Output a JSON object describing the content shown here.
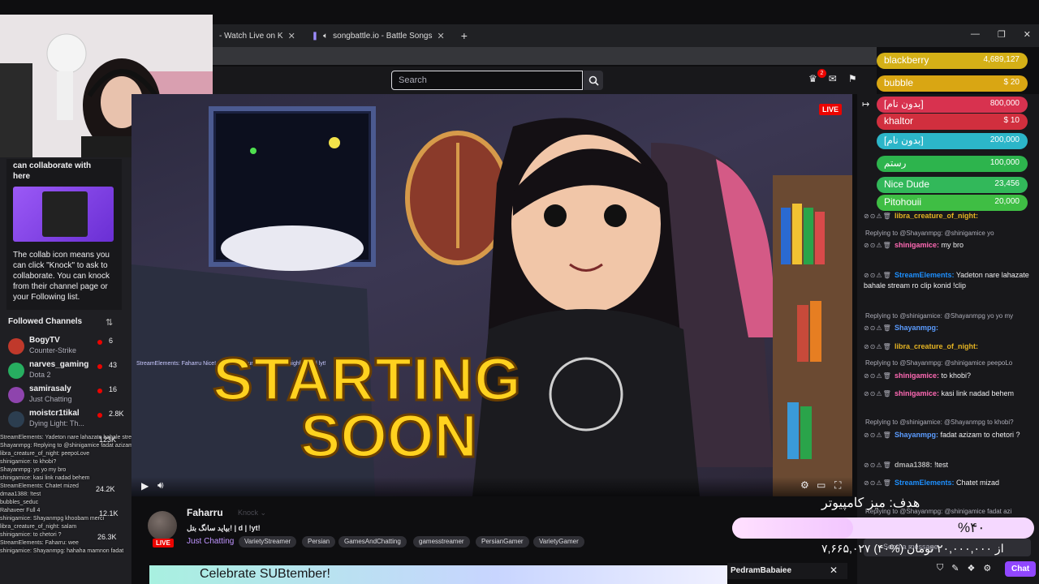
{
  "browser": {
    "tabs": [
      {
        "label": "- Watch Live on K",
        "icon": "twitch-icon"
      },
      {
        "label": "songbattle.io - Battle Songs",
        "icon": "speaker-icon"
      }
    ],
    "new_tab": "+",
    "window_controls": [
      "—",
      "❐",
      "✕"
    ]
  },
  "topnav": {
    "search_placeholder": "Search",
    "notification_count": "2"
  },
  "sidebar": {
    "tip": {
      "heading": "can collaborate with here",
      "body": "The collab icon means you can click \"Knock\" to ask to collaborate. You can knock from their channel page or your Following list."
    },
    "followed_title": "Followed Channels",
    "channels": [
      {
        "name": "BogyTV",
        "game": "Counter-Strike",
        "viewers": "6",
        "color": "#c0392b"
      },
      {
        "name": "narves_gaming",
        "game": "Dota 2",
        "viewers": "43",
        "color": "#27ae60"
      },
      {
        "name": "samirasaly",
        "game": "Just Chatting",
        "viewers": "16",
        "color": "#8e44ad"
      },
      {
        "name": "moistcr1tikal",
        "game": "Dying Light: Th...",
        "viewers": "2.8K",
        "color": "#2c3e50"
      }
    ],
    "overlay_counts": [
      "123K",
      "24.2K",
      "12.1K",
      "26.3K"
    ]
  },
  "overlay_chat": [
    "StreamElements: Yadeton nare lahazate bahale stream ro clip konid",
    "Shayanmpg: Replying to @shinigamice fadat azizam",
    "libra_creature_of_night: peepoLove",
    "shinigamice: to khobi?",
    "Shayanmpg: yo yo my bro",
    "shinigamice: kasi link nadad behem",
    "StreamElements: Chatet mized",
    "dmaa1388: !test",
    "bubbles_seduc",
    "Rahaveer Full 4",
    "shinigamice: Shayanmpg khoobam merci",
    "libra_creature_of_night: salam",
    "shinigamice: to chetori ?",
    "StreamElements: Faharru: wee",
    "shinigamice: Shayanmpg: hahaha mamnon fadat"
  ],
  "video": {
    "live_label": "LIVE",
    "headline_1": "STARTING",
    "headline_2": "SOON",
    "ticker": "StreamElements: Faharru Nice! Check out our latest stream highlights! | lyt!"
  },
  "stream": {
    "streamer": "Faharru",
    "knock_label": "Knock",
    "title": "بیاید سانگ بتل! | d | !yt!",
    "category": "Just Chatting",
    "live_label": "LIVE",
    "tags": [
      "VarietyStreamer",
      "Persian",
      "GamesAndChatting",
      "gamesstreamer",
      "PersianGamer",
      "VarietyGamer"
    ],
    "sub_banner": "Celebrate SUBtember!",
    "popup_user": "PedramBabaiee"
  },
  "goal": {
    "title": "هدف: میز کامپیوتر",
    "percent_label": "%۴۰",
    "progress": 0.4,
    "amount": "۷,۶۶۵,۰۲۷ از ۲۰,۰۰۰,۰۰۰ تومان (%۴۰)"
  },
  "leaderboard": [
    {
      "name": "blackberry",
      "amount": "4,689,127",
      "color": "#d4b017"
    },
    {
      "name": "bubble",
      "amount": "$ 20",
      "color": "#d9a613"
    },
    {
      "name": "[بدون نام]",
      "amount": "800,000",
      "color": "#d8324f"
    },
    {
      "name": "khaltor",
      "amount": "$ 10",
      "color": "#d12f3e"
    },
    {
      "name": "[بدون نام]",
      "amount": "200,000",
      "color": "#2cb6c9"
    },
    {
      "name": "رستم",
      "amount": "100,000",
      "color": "#2db44d"
    },
    {
      "name": "Nice Dude",
      "amount": "23,456",
      "color": "#32b85a"
    },
    {
      "name": "Pitohouii",
      "amount": "20,000",
      "color": "#3fbe44"
    }
  ],
  "chat": {
    "messages": [
      {
        "type": "msg",
        "user": "libra_creature_of_night:",
        "user_color": "#e6b422",
        "text": ""
      },
      {
        "type": "reply",
        "text": "Replying to @Shayanmpg: @shinigamice yo"
      },
      {
        "type": "msg",
        "user": "shinigamice:",
        "user_color": "#ff69b4",
        "text": "my bro"
      },
      {
        "type": "msg",
        "user": "StreamElements:",
        "user_color": "#1e90ff",
        "text": "Yadeton nare lahazate bahale stream ro clip konid !clip"
      },
      {
        "type": "reply",
        "text": "Replying to @shinigamice: @Shayanmpg yo yo my"
      },
      {
        "type": "msg",
        "user": "Shayanmpg:",
        "user_color": "#5b9cff",
        "text": ""
      },
      {
        "type": "msg",
        "user": "libra_creature_of_night:",
        "user_color": "#e6b422",
        "text": ""
      },
      {
        "type": "reply",
        "text": "Replying to @Shayanmpg: @shinigamice peepoLo"
      },
      {
        "type": "msg",
        "user": "shinigamice:",
        "user_color": "#ff69b4",
        "text": "to khobi?"
      },
      {
        "type": "msg",
        "user": "shinigamice:",
        "user_color": "#ff69b4",
        "text": "kasi link nadad behem"
      },
      {
        "type": "reply",
        "text": "Replying to @shinigamice: @Shayanmpg to khobi?"
      },
      {
        "type": "msg",
        "user": "Shayanmpg:",
        "user_color": "#5b9cff",
        "text": "fadat azizam to chetori ?"
      },
      {
        "type": "msg",
        "user": "dmaa1388:",
        "user_color": "#b0b0b0",
        "text": "!test"
      },
      {
        "type": "msg",
        "user": "StreamElements:",
        "user_color": "#1e90ff",
        "text": "Chatet mizad"
      },
      {
        "type": "reply",
        "text": "Replying to @Shayanmpg: @shinigamice fadat azi"
      }
    ],
    "send_placeholder": "Send a message",
    "chat_button": "Chat"
  }
}
